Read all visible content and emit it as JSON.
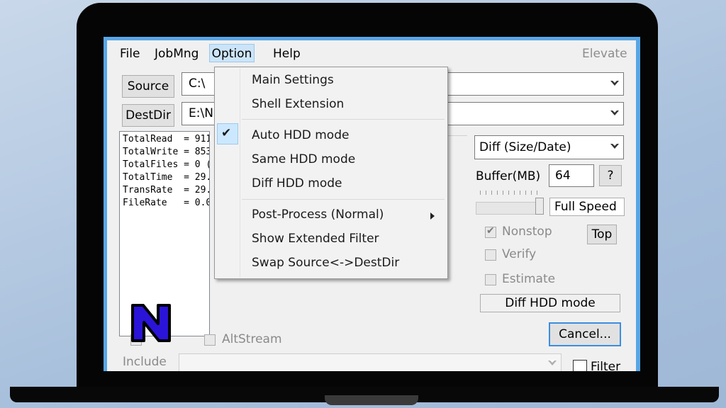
{
  "menubar": {
    "file": "File",
    "jobmng": "JobMng",
    "option": "Option",
    "help": "Help",
    "elevate": "Elevate"
  },
  "source": {
    "button": "Source",
    "value": "C:\\"
  },
  "destdir": {
    "button": "DestDir",
    "value": "E:\\N"
  },
  "log_lines": [
    "TotalRead  = 911",
    "TotalWrite = 853",
    "TotalFiles = 0 (",
    "TotalTime  = 29.",
    "TransRate  = 29.",
    "FileRate   = 0.0"
  ],
  "option_menu": {
    "items": [
      "Main Settings",
      "Shell Extension",
      "Auto HDD mode",
      "Same HDD mode",
      "Diff HDD mode",
      "Post-Process (Normal)",
      "Show Extended Filter",
      "Swap Source<->DestDir"
    ],
    "checked_item": "Auto HDD mode"
  },
  "right_panel": {
    "mode_select": "Diff (Size/Date)",
    "buffer_label": "Buffer(MB)",
    "buffer_value": "64",
    "help_button": "?",
    "speed_label": "Full Speed",
    "nonstop_label": "Nonstop",
    "nonstop_checked": true,
    "verify_label": "Verify",
    "estimate_label": "Estimate",
    "top_button": "Top",
    "hdd_mode_status": "Diff HDD mode",
    "cancel_button": "Cancel..."
  },
  "bottom": {
    "altstream_label": "AltStream",
    "include_label": "Include",
    "filter_label": "Filter"
  },
  "overlay_logo": "N",
  "colors": {
    "accent_blue": "#59a6e6",
    "menu_highlight": "#cce4f7",
    "logo_fill": "#2a14d8"
  }
}
